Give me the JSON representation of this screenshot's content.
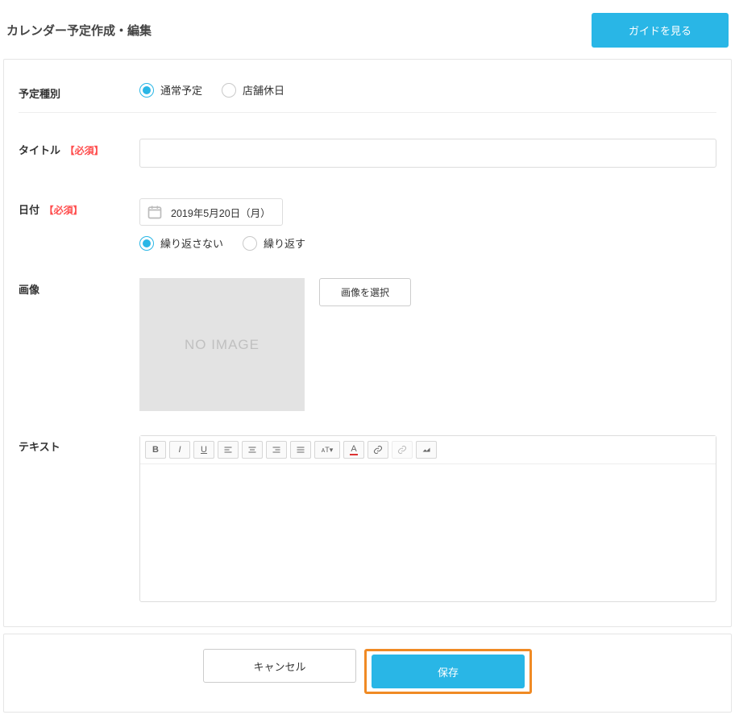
{
  "header": {
    "title": "カレンダー予定作成・編集",
    "guide_button": "ガイドを見る"
  },
  "labels": {
    "schedule_type": "予定種別",
    "title": "タイトル",
    "date": "日付",
    "image": "画像",
    "text": "テキスト",
    "required": "【必須】"
  },
  "schedule_type": {
    "options": [
      {
        "label": "通常予定",
        "selected": true
      },
      {
        "label": "店舗休日",
        "selected": false
      }
    ]
  },
  "title_field": {
    "value": ""
  },
  "date_field": {
    "value": "2019年5月20日（月）",
    "repeat_options": [
      {
        "label": "繰り返さない",
        "selected": true
      },
      {
        "label": "繰り返す",
        "selected": false
      }
    ]
  },
  "image_field": {
    "placeholder_text": "NO IMAGE",
    "select_button": "画像を選択"
  },
  "editor_toolbar": {
    "buttons": [
      "bold",
      "italic",
      "underline",
      "align-left",
      "align-center",
      "align-right",
      "align-justify",
      "font-size",
      "font-color",
      "link",
      "unlink",
      "clear-format"
    ]
  },
  "footer": {
    "cancel": "キャンセル",
    "save": "保存"
  }
}
